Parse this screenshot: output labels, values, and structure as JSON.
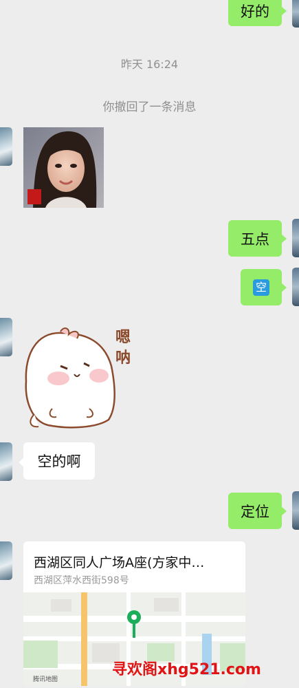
{
  "messages": {
    "first_reply": "好的",
    "timestamp": "昨天 16:24",
    "recalled_notice": "你撤回了一条消息",
    "five_oclock": "五点",
    "empty_emoji": "🈳",
    "sticker_text": "嗯呐",
    "left_reply": "空的啊",
    "locate": "定位"
  },
  "location_card": {
    "title": "西湖区同人广场A座(方家中…",
    "address": "西湖区萍水西街598号",
    "map_provider": "腾讯地图"
  },
  "watermark": "寻欢阁xhg521.com",
  "colors": {
    "background": "#ededed",
    "sent_bubble": "#95ec69",
    "received_bubble": "#ffffff",
    "map_pin": "#1aad5a",
    "watermark": "#e01414"
  }
}
